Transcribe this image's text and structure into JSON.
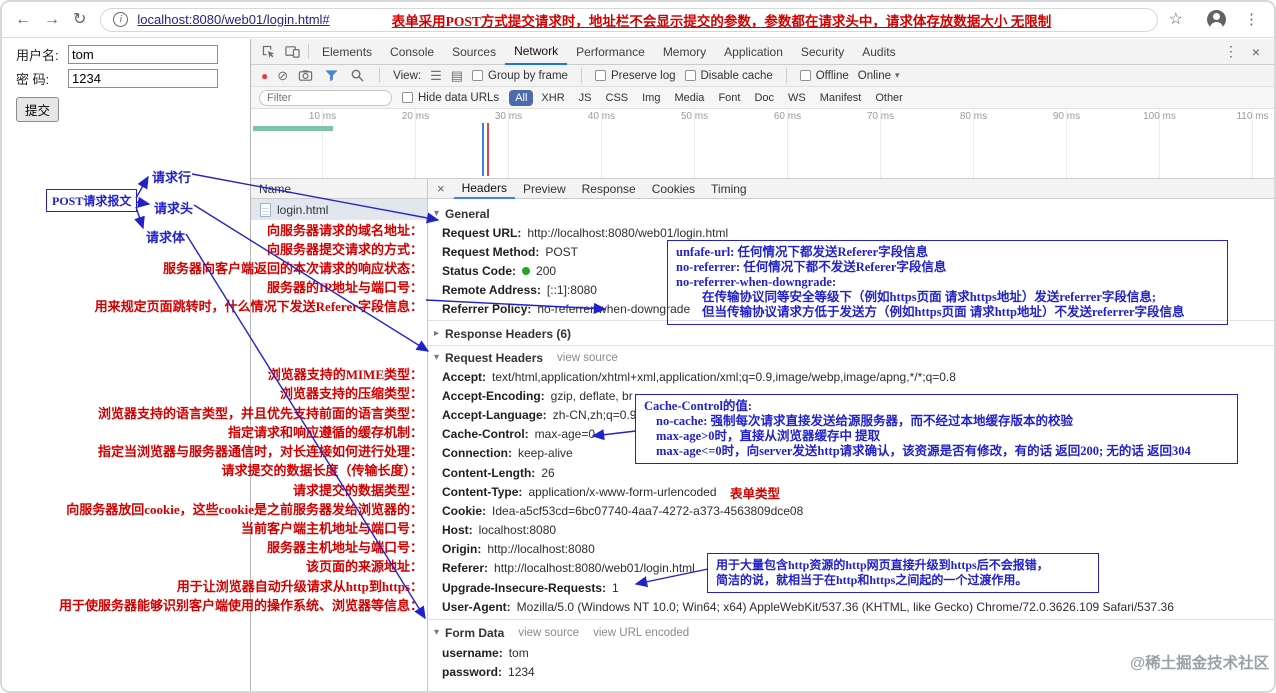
{
  "browser": {
    "url": "localhost:8080/web01/login.html#",
    "annotation": "表单采用POST方式提交请求时，地址栏不会显示提交的参数，参数都在请求头中，请求体存放数据大小 无限制"
  },
  "login_form": {
    "username_label": "用户名:",
    "username_value": "tom",
    "password_label": "密 码:",
    "password_value": "1234",
    "submit_label": "提交"
  },
  "icons": {
    "back": "←",
    "forward": "→",
    "refresh": "↻",
    "info": "i",
    "star": "☆",
    "menu": "⋮",
    "overflow": "⋮",
    "close": "×",
    "record": "●",
    "clear": "⊘",
    "view_list": "☰",
    "view_grid": "▤",
    "caret_down": "▾",
    "tri_open": "▾",
    "tri_closed": "▸"
  },
  "devtools": {
    "tabs": [
      "Elements",
      "Console",
      "Sources",
      "Network",
      "Performance",
      "Memory",
      "Application",
      "Security",
      "Audits"
    ],
    "active_tab": "Network",
    "toolbar": {
      "view_label": "View:",
      "group_by_frame": "Group by frame",
      "preserve_log": "Preserve log",
      "disable_cache": "Disable cache",
      "offline": "Offline",
      "throttling": "Online"
    },
    "filter_bar": {
      "placeholder": "Filter",
      "hide_data_urls": "Hide data URLs",
      "pills": [
        "All",
        "XHR",
        "JS",
        "CSS",
        "Img",
        "Media",
        "Font",
        "Doc",
        "WS",
        "Manifest",
        "Other"
      ],
      "active_pill": "All"
    },
    "timeline_labels": [
      "10 ms",
      "20 ms",
      "30 ms",
      "40 ms",
      "50 ms",
      "60 ms",
      "70 ms",
      "80 ms",
      "90 ms",
      "100 ms",
      "110 ms"
    ],
    "requests": {
      "header": "Name",
      "rows": [
        "login.html"
      ]
    },
    "detail_tabs": [
      "Headers",
      "Preview",
      "Response",
      "Cookies",
      "Timing"
    ],
    "active_detail_tab": "Headers",
    "general": {
      "title": "General",
      "rows": [
        {
          "k": "Request URL:",
          "v": "http://localhost:8080/web01/login.html"
        },
        {
          "k": "Request Method:",
          "v": "POST"
        },
        {
          "k": "Status Code:",
          "v": "200"
        },
        {
          "k": "Remote Address:",
          "v": "[::1]:8080"
        },
        {
          "k": "Referrer Policy:",
          "v": "no-referrer-when-downgrade"
        }
      ]
    },
    "response_headers": {
      "title": "Response Headers (6)"
    },
    "request_headers": {
      "title": "Request Headers",
      "view_source": "view source",
      "rows": [
        {
          "k": "Accept:",
          "v": "text/html,application/xhtml+xml,application/xml;q=0.9,image/webp,image/apng,*/*;q=0.8"
        },
        {
          "k": "Accept-Encoding:",
          "v": "gzip, deflate, br"
        },
        {
          "k": "Accept-Language:",
          "v": "zh-CN,zh;q=0.9"
        },
        {
          "k": "Cache-Control:",
          "v": "max-age=0"
        },
        {
          "k": "Connection:",
          "v": "keep-alive"
        },
        {
          "k": "Content-Length:",
          "v": "26"
        },
        {
          "k": "Content-Type:",
          "v": "application/x-www-form-urlencoded"
        },
        {
          "k": "Cookie:",
          "v": "Idea-a5cf53cd=6bc07740-4aa7-4272-a373-4563809dce08"
        },
        {
          "k": "Host:",
          "v": "localhost:8080"
        },
        {
          "k": "Origin:",
          "v": "http://localhost:8080"
        },
        {
          "k": "Referer:",
          "v": "http://localhost:8080/web01/login.html"
        },
        {
          "k": "Upgrade-Insecure-Requests:",
          "v": "1"
        },
        {
          "k": "User-Agent:",
          "v": "Mozilla/5.0 (Windows NT 10.0; Win64; x64) AppleWebKit/537.36 (KHTML, like Gecko) Chrome/72.0.3626.109 Safari/537.36"
        }
      ]
    },
    "form_data": {
      "title": "Form Data",
      "view_source": "view source",
      "view_url_encoded": "view URL encoded",
      "rows": [
        {
          "k": "username:",
          "v": "tom"
        },
        {
          "k": "password:",
          "v": "1234"
        }
      ]
    }
  },
  "annotations": {
    "post_message_box": "POST请求报文",
    "request_line_label": "请求行",
    "request_header_label": "请求头",
    "request_body_label": "请求体",
    "content_type_note": "表单类型",
    "left_notes": [
      "向服务器请求的域名地址：",
      "向服务器提交请求的方式：",
      "服务器向客户端返回的本次请求的响应状态：",
      "服务器的IP地址与端口号：",
      "用来规定页面跳转时，什么情况下发送Referer字段信息：",
      "浏览器支持的MIME类型：",
      "浏览器支持的压缩类型：",
      "浏览器支持的语言类型，并且优先支持前面的语言类型：",
      "指定请求和响应遵循的缓存机制：",
      "指定当浏览器与服务器通信时，对长连接如何进行处理：",
      "请求提交的数据长度（传输长度）：",
      "请求提交的数据类型：",
      "向服务器放回cookie，这些cookie是之前服务器发给浏览器的：",
      "当前客户端主机地址与端口号：",
      "服务器主机地址与端口号：",
      "该页面的来源地址：",
      "用于让浏览器自动升级请求从http到https：",
      "用于使服务器能够识别客户端使用的操作系统、浏览器等信息："
    ],
    "referrer_box": [
      "unfafe-url: 任何情况下都发送Referer字段信息",
      "no-referrer: 任何情况下都不发送Referer字段信息",
      "no-referrer-when-downgrade:",
      "在传输协议同等安全等级下（例如https页面 请求https地址）发送referrer字段信息;",
      "但当传输协议请求方低于发送方（例如https页面 请求http地址）不发送referrer字段信息"
    ],
    "cache_box": [
      "Cache-Control的值:",
      "no-cache: 强制每次请求直接发送给源服务器，而不经过本地缓存版本的校验",
      "max-age>0时，直接从浏览器缓存中 提取",
      "max-age<=0时，向server发送http请求确认，该资源是否有修改，有的话 返回200; 无的话 返回304"
    ],
    "upgrade_box": [
      "用于大量包含http资源的http网页直接升级到https后不会报错，",
      "简洁的说，就相当于在http和https之间起的一个过渡作用。"
    ]
  },
  "watermark": "@稀土掘金技术社区",
  "colors": {
    "annotation_red": "#d40000",
    "annotation_blue": "#2222cc",
    "status_green": "#27a427",
    "active_pill_bg": "#4d6bab",
    "devtools_accent": "#1a73e8"
  }
}
